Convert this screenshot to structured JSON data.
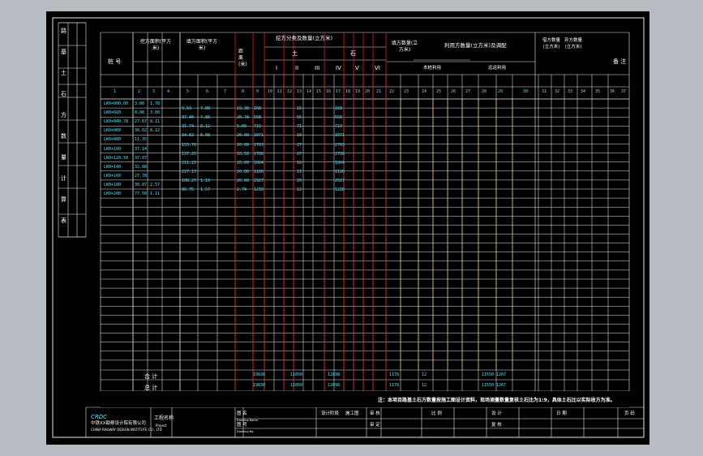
{
  "drawing": {
    "title": "土石方数量计算表",
    "side_labels": [
      "路",
      "基",
      "土",
      "石",
      "方",
      "数",
      "量",
      "计",
      "算",
      "表"
    ],
    "col_groups": {
      "station": "桩 号",
      "cut_area": "挖方面积(平方米)",
      "fill_area": "填方面积(平方米)",
      "cut_volume": "挖方分类及数量(立方米)",
      "fill_volume": "填方数量(立方米)",
      "reuse": "利用方数量(立方米)及调配",
      "borrow": "借方数量(立方米)",
      "waste": "弃方数量(立方米)",
      "remark": "备 注"
    },
    "sub_labels": {
      "soil": "土",
      "rock": "石",
      "total": "总",
      "length": "距 离 (米)",
      "local": "本桩利用",
      "far": "远运利用",
      "grades": [
        "I",
        "II",
        "III",
        "IV",
        "V",
        "VI"
      ]
    },
    "col_numbers": [
      "1",
      "2",
      "3",
      "4",
      "5",
      "6",
      "7",
      "8",
      "9",
      "10",
      "11",
      "12",
      "13",
      "14",
      "15",
      "16",
      "17",
      "18",
      "19",
      "20",
      "21",
      "22",
      "23",
      "24",
      "25",
      "26",
      "27",
      "28",
      "29",
      "30",
      "31",
      "32",
      "33",
      "34",
      "35",
      "36",
      "37"
    ],
    "rows": [
      {
        "station": "LK0+000.00",
        "a": "3.00",
        "b": "1.78",
        "c": "",
        "d": "",
        "len": "",
        "v": ""
      },
      {
        "station": "LK0+020",
        "a": "8.08",
        "b": "3.00",
        "c": "9.63",
        "d": "7.88",
        "len": "19.38",
        "v": "168"
      },
      {
        "station": "LK0+040.78",
        "a": "27.67",
        "b": "8.11",
        "c": "37.40",
        "d": "7.88",
        "len": "20.78",
        "v": "558"
      },
      {
        "station": "LK0+060",
        "a": "36.02",
        "b": "8.12",
        "c": "31.74",
        "d": "8.12",
        "len": "5.00",
        "v": "719"
      },
      {
        "station": "LK0+080",
        "a": "11.35",
        "b": "",
        "c": "34.82",
        "d": "8.08",
        "len": "20.00",
        "v": "1071"
      },
      {
        "station": "LK0+100",
        "a": "37.14",
        "b": "",
        "c": "133.70",
        "d": "",
        "len": "20.00",
        "v": "2703"
      },
      {
        "station": "LK0+120.50",
        "a": "37.07",
        "b": "",
        "c": "137.25",
        "d": "",
        "len": "10.50",
        "v": "2708"
      },
      {
        "station": "LK0+140",
        "a": "32.88",
        "b": "",
        "c": "211.22",
        "d": "",
        "len": "20.00",
        "v": "1004"
      },
      {
        "station": "LK0+160",
        "a": "27.78",
        "b": "",
        "c": "227.17",
        "d": "",
        "len": "20.00",
        "v": "1180"
      },
      {
        "station": "LK0+180",
        "a": "30.87",
        "b": "2.57",
        "c": "108.27",
        "d": "1.19",
        "len": "20.00",
        "v": "2927"
      },
      {
        "station": "LK0+200",
        "a": "77.50",
        "b": "1.11",
        "c": "80.75",
        "d": "1.57",
        "len": "2.74",
        "v": "1210"
      }
    ],
    "totals_label": "合 计",
    "totals2_label": "总 计",
    "totals": {
      "v": "19838",
      "a": "11850",
      "b": "12898",
      "c": "1178",
      "d": "12",
      "e": "11550",
      "f": "1267"
    },
    "footnote": "注：本项目路基土石方数量按施工图设计资料，现场测量数量复核土石比为1:9，具体土石比以实际收方为准。",
    "titleblock": {
      "company_cn": "中铁XX勘察设计院有限公司",
      "company_en": "CHINA RAILWAY DESIGN INSTITUTE CO., LTD",
      "logo": "CRDC",
      "project_label": "工程名称",
      "project_en": "Project",
      "f1": "图 名",
      "f1en": "Drawing Name",
      "f2": "图 号",
      "f2en": "Drawing No.",
      "f3": "设计阶段",
      "f4": "施工图",
      "f5": "审 核",
      "f6": "审 定",
      "f7": "比 例",
      "f8": "设 计",
      "f9": "复 核",
      "f10": "日 期",
      "f11": "页 码"
    }
  }
}
